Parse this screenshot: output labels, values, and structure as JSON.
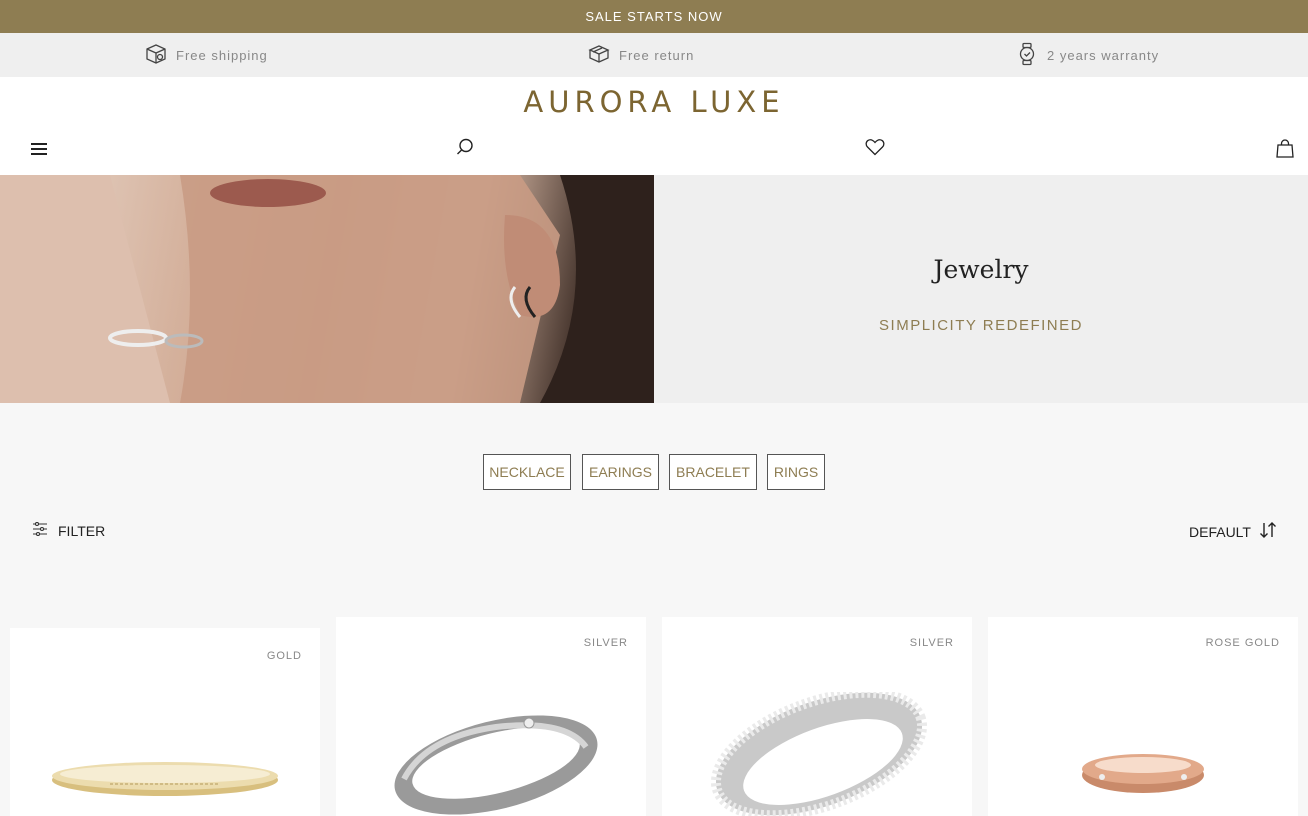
{
  "announcement": {
    "text": "SALE STARTS NOW"
  },
  "perks": [
    {
      "icon": "box-icon",
      "label": "Free shipping"
    },
    {
      "icon": "return-box-icon",
      "label": "Free return"
    },
    {
      "icon": "watch-icon",
      "label": "2 years warranty"
    }
  ],
  "brand": {
    "name": "AURORA LUXE"
  },
  "hero": {
    "title": "Jewelry",
    "subtitle": "SIMPLICITY REDEFINED"
  },
  "categories": [
    "NECKLACE",
    "EARINGS",
    "BRACELET",
    "RINGS"
  ],
  "toolbar": {
    "filter_label": "FILTER",
    "sort_label": "DEFAULT"
  },
  "products": [
    {
      "tag": "GOLD",
      "item": "cuff bracelet"
    },
    {
      "tag": "SILVER",
      "item": "band ring"
    },
    {
      "tag": "SILVER",
      "item": "pavé ring"
    },
    {
      "tag": "ROSE GOLD",
      "item": "band ring"
    }
  ],
  "colors": {
    "accent": "#8e7d52",
    "brand": "#7c6531",
    "perk_bar": "#efefef"
  }
}
